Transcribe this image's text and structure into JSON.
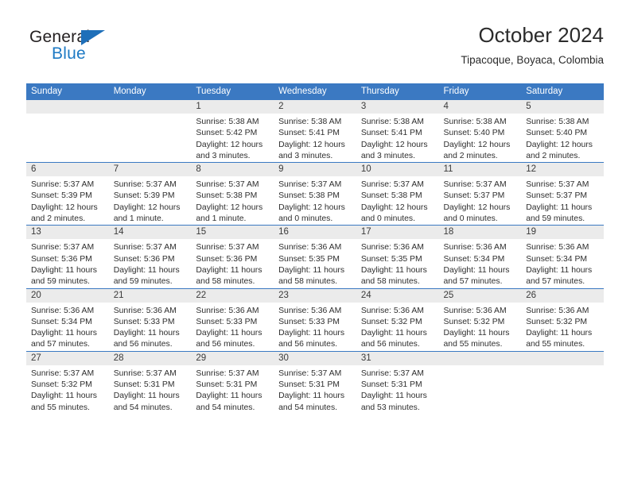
{
  "brand": {
    "name_part1": "General",
    "name_part2": "Blue",
    "accent_color": "#1e7ac4",
    "triangle_color": "#1e6fb9"
  },
  "header": {
    "title": "October 2024",
    "subtitle": "Tipacoque, Boyaca, Colombia"
  },
  "calendar": {
    "header_background": "#3b79c2",
    "daynum_background": "#ebebeb",
    "weekday_headers": [
      "Sunday",
      "Monday",
      "Tuesday",
      "Wednesday",
      "Thursday",
      "Friday",
      "Saturday"
    ],
    "weeks": [
      [
        {
          "day": "",
          "sunrise": "",
          "sunset": "",
          "daylight_line1": "",
          "daylight_line2": ""
        },
        {
          "day": "",
          "sunrise": "",
          "sunset": "",
          "daylight_line1": "",
          "daylight_line2": ""
        },
        {
          "day": "1",
          "sunrise": "Sunrise: 5:38 AM",
          "sunset": "Sunset: 5:42 PM",
          "daylight_line1": "Daylight: 12 hours",
          "daylight_line2": "and 3 minutes."
        },
        {
          "day": "2",
          "sunrise": "Sunrise: 5:38 AM",
          "sunset": "Sunset: 5:41 PM",
          "daylight_line1": "Daylight: 12 hours",
          "daylight_line2": "and 3 minutes."
        },
        {
          "day": "3",
          "sunrise": "Sunrise: 5:38 AM",
          "sunset": "Sunset: 5:41 PM",
          "daylight_line1": "Daylight: 12 hours",
          "daylight_line2": "and 3 minutes."
        },
        {
          "day": "4",
          "sunrise": "Sunrise: 5:38 AM",
          "sunset": "Sunset: 5:40 PM",
          "daylight_line1": "Daylight: 12 hours",
          "daylight_line2": "and 2 minutes."
        },
        {
          "day": "5",
          "sunrise": "Sunrise: 5:38 AM",
          "sunset": "Sunset: 5:40 PM",
          "daylight_line1": "Daylight: 12 hours",
          "daylight_line2": "and 2 minutes."
        }
      ],
      [
        {
          "day": "6",
          "sunrise": "Sunrise: 5:37 AM",
          "sunset": "Sunset: 5:39 PM",
          "daylight_line1": "Daylight: 12 hours",
          "daylight_line2": "and 2 minutes."
        },
        {
          "day": "7",
          "sunrise": "Sunrise: 5:37 AM",
          "sunset": "Sunset: 5:39 PM",
          "daylight_line1": "Daylight: 12 hours",
          "daylight_line2": "and 1 minute."
        },
        {
          "day": "8",
          "sunrise": "Sunrise: 5:37 AM",
          "sunset": "Sunset: 5:38 PM",
          "daylight_line1": "Daylight: 12 hours",
          "daylight_line2": "and 1 minute."
        },
        {
          "day": "9",
          "sunrise": "Sunrise: 5:37 AM",
          "sunset": "Sunset: 5:38 PM",
          "daylight_line1": "Daylight: 12 hours",
          "daylight_line2": "and 0 minutes."
        },
        {
          "day": "10",
          "sunrise": "Sunrise: 5:37 AM",
          "sunset": "Sunset: 5:38 PM",
          "daylight_line1": "Daylight: 12 hours",
          "daylight_line2": "and 0 minutes."
        },
        {
          "day": "11",
          "sunrise": "Sunrise: 5:37 AM",
          "sunset": "Sunset: 5:37 PM",
          "daylight_line1": "Daylight: 12 hours",
          "daylight_line2": "and 0 minutes."
        },
        {
          "day": "12",
          "sunrise": "Sunrise: 5:37 AM",
          "sunset": "Sunset: 5:37 PM",
          "daylight_line1": "Daylight: 11 hours",
          "daylight_line2": "and 59 minutes."
        }
      ],
      [
        {
          "day": "13",
          "sunrise": "Sunrise: 5:37 AM",
          "sunset": "Sunset: 5:36 PM",
          "daylight_line1": "Daylight: 11 hours",
          "daylight_line2": "and 59 minutes."
        },
        {
          "day": "14",
          "sunrise": "Sunrise: 5:37 AM",
          "sunset": "Sunset: 5:36 PM",
          "daylight_line1": "Daylight: 11 hours",
          "daylight_line2": "and 59 minutes."
        },
        {
          "day": "15",
          "sunrise": "Sunrise: 5:37 AM",
          "sunset": "Sunset: 5:36 PM",
          "daylight_line1": "Daylight: 11 hours",
          "daylight_line2": "and 58 minutes."
        },
        {
          "day": "16",
          "sunrise": "Sunrise: 5:36 AM",
          "sunset": "Sunset: 5:35 PM",
          "daylight_line1": "Daylight: 11 hours",
          "daylight_line2": "and 58 minutes."
        },
        {
          "day": "17",
          "sunrise": "Sunrise: 5:36 AM",
          "sunset": "Sunset: 5:35 PM",
          "daylight_line1": "Daylight: 11 hours",
          "daylight_line2": "and 58 minutes."
        },
        {
          "day": "18",
          "sunrise": "Sunrise: 5:36 AM",
          "sunset": "Sunset: 5:34 PM",
          "daylight_line1": "Daylight: 11 hours",
          "daylight_line2": "and 57 minutes."
        },
        {
          "day": "19",
          "sunrise": "Sunrise: 5:36 AM",
          "sunset": "Sunset: 5:34 PM",
          "daylight_line1": "Daylight: 11 hours",
          "daylight_line2": "and 57 minutes."
        }
      ],
      [
        {
          "day": "20",
          "sunrise": "Sunrise: 5:36 AM",
          "sunset": "Sunset: 5:34 PM",
          "daylight_line1": "Daylight: 11 hours",
          "daylight_line2": "and 57 minutes."
        },
        {
          "day": "21",
          "sunrise": "Sunrise: 5:36 AM",
          "sunset": "Sunset: 5:33 PM",
          "daylight_line1": "Daylight: 11 hours",
          "daylight_line2": "and 56 minutes."
        },
        {
          "day": "22",
          "sunrise": "Sunrise: 5:36 AM",
          "sunset": "Sunset: 5:33 PM",
          "daylight_line1": "Daylight: 11 hours",
          "daylight_line2": "and 56 minutes."
        },
        {
          "day": "23",
          "sunrise": "Sunrise: 5:36 AM",
          "sunset": "Sunset: 5:33 PM",
          "daylight_line1": "Daylight: 11 hours",
          "daylight_line2": "and 56 minutes."
        },
        {
          "day": "24",
          "sunrise": "Sunrise: 5:36 AM",
          "sunset": "Sunset: 5:32 PM",
          "daylight_line1": "Daylight: 11 hours",
          "daylight_line2": "and 56 minutes."
        },
        {
          "day": "25",
          "sunrise": "Sunrise: 5:36 AM",
          "sunset": "Sunset: 5:32 PM",
          "daylight_line1": "Daylight: 11 hours",
          "daylight_line2": "and 55 minutes."
        },
        {
          "day": "26",
          "sunrise": "Sunrise: 5:36 AM",
          "sunset": "Sunset: 5:32 PM",
          "daylight_line1": "Daylight: 11 hours",
          "daylight_line2": "and 55 minutes."
        }
      ],
      [
        {
          "day": "27",
          "sunrise": "Sunrise: 5:37 AM",
          "sunset": "Sunset: 5:32 PM",
          "daylight_line1": "Daylight: 11 hours",
          "daylight_line2": "and 55 minutes."
        },
        {
          "day": "28",
          "sunrise": "Sunrise: 5:37 AM",
          "sunset": "Sunset: 5:31 PM",
          "daylight_line1": "Daylight: 11 hours",
          "daylight_line2": "and 54 minutes."
        },
        {
          "day": "29",
          "sunrise": "Sunrise: 5:37 AM",
          "sunset": "Sunset: 5:31 PM",
          "daylight_line1": "Daylight: 11 hours",
          "daylight_line2": "and 54 minutes."
        },
        {
          "day": "30",
          "sunrise": "Sunrise: 5:37 AM",
          "sunset": "Sunset: 5:31 PM",
          "daylight_line1": "Daylight: 11 hours",
          "daylight_line2": "and 54 minutes."
        },
        {
          "day": "31",
          "sunrise": "Sunrise: 5:37 AM",
          "sunset": "Sunset: 5:31 PM",
          "daylight_line1": "Daylight: 11 hours",
          "daylight_line2": "and 53 minutes."
        },
        {
          "day": "",
          "sunrise": "",
          "sunset": "",
          "daylight_line1": "",
          "daylight_line2": ""
        },
        {
          "day": "",
          "sunrise": "",
          "sunset": "",
          "daylight_line1": "",
          "daylight_line2": ""
        }
      ]
    ]
  }
}
